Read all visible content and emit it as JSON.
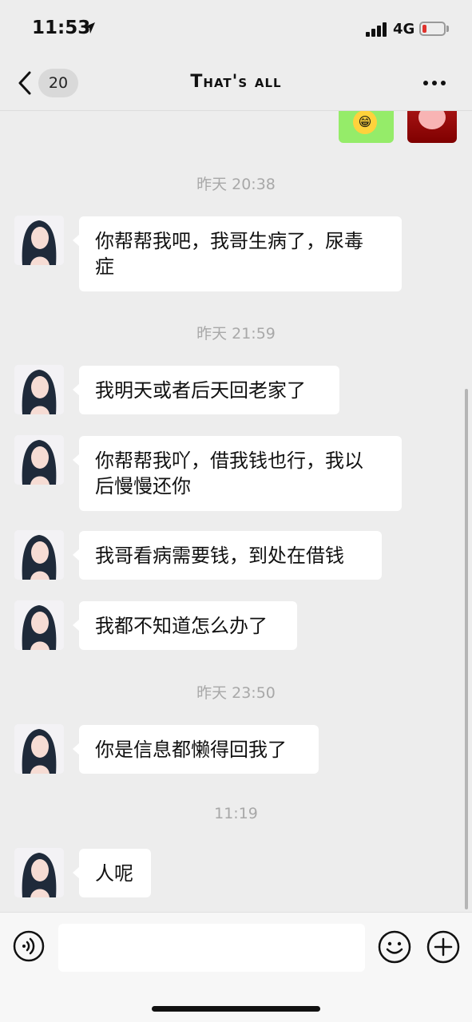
{
  "status_bar": {
    "time": "11:53",
    "network": "4G"
  },
  "nav": {
    "unread_count": "20",
    "title": "That's all"
  },
  "messages": [
    {
      "timestamp": "昨天 20:38",
      "text_line1": "你帮帮我吧，我哥生病了，尿毒",
      "text_line2": "症"
    },
    {
      "timestamp": "昨天 21:59",
      "text": "我明天或者后天回老家了"
    },
    {
      "text_line1": "你帮帮我吖，借我钱也行，我以",
      "text_line2": "后慢慢还你"
    },
    {
      "text": "我哥看病需要钱，到处在借钱"
    },
    {
      "text": "我都不知道怎么办了"
    },
    {
      "timestamp": "昨天 23:50",
      "text": "你是信息都懒得回我了"
    },
    {
      "timestamp": "11:19",
      "text": "人呢"
    }
  ],
  "input_bar": {
    "placeholder": ""
  },
  "icons": {
    "back": "chevron-left-icon",
    "more": "more-dots-icon",
    "voice": "voice-icon",
    "emoji": "emoji-icon",
    "plus": "plus-icon"
  }
}
